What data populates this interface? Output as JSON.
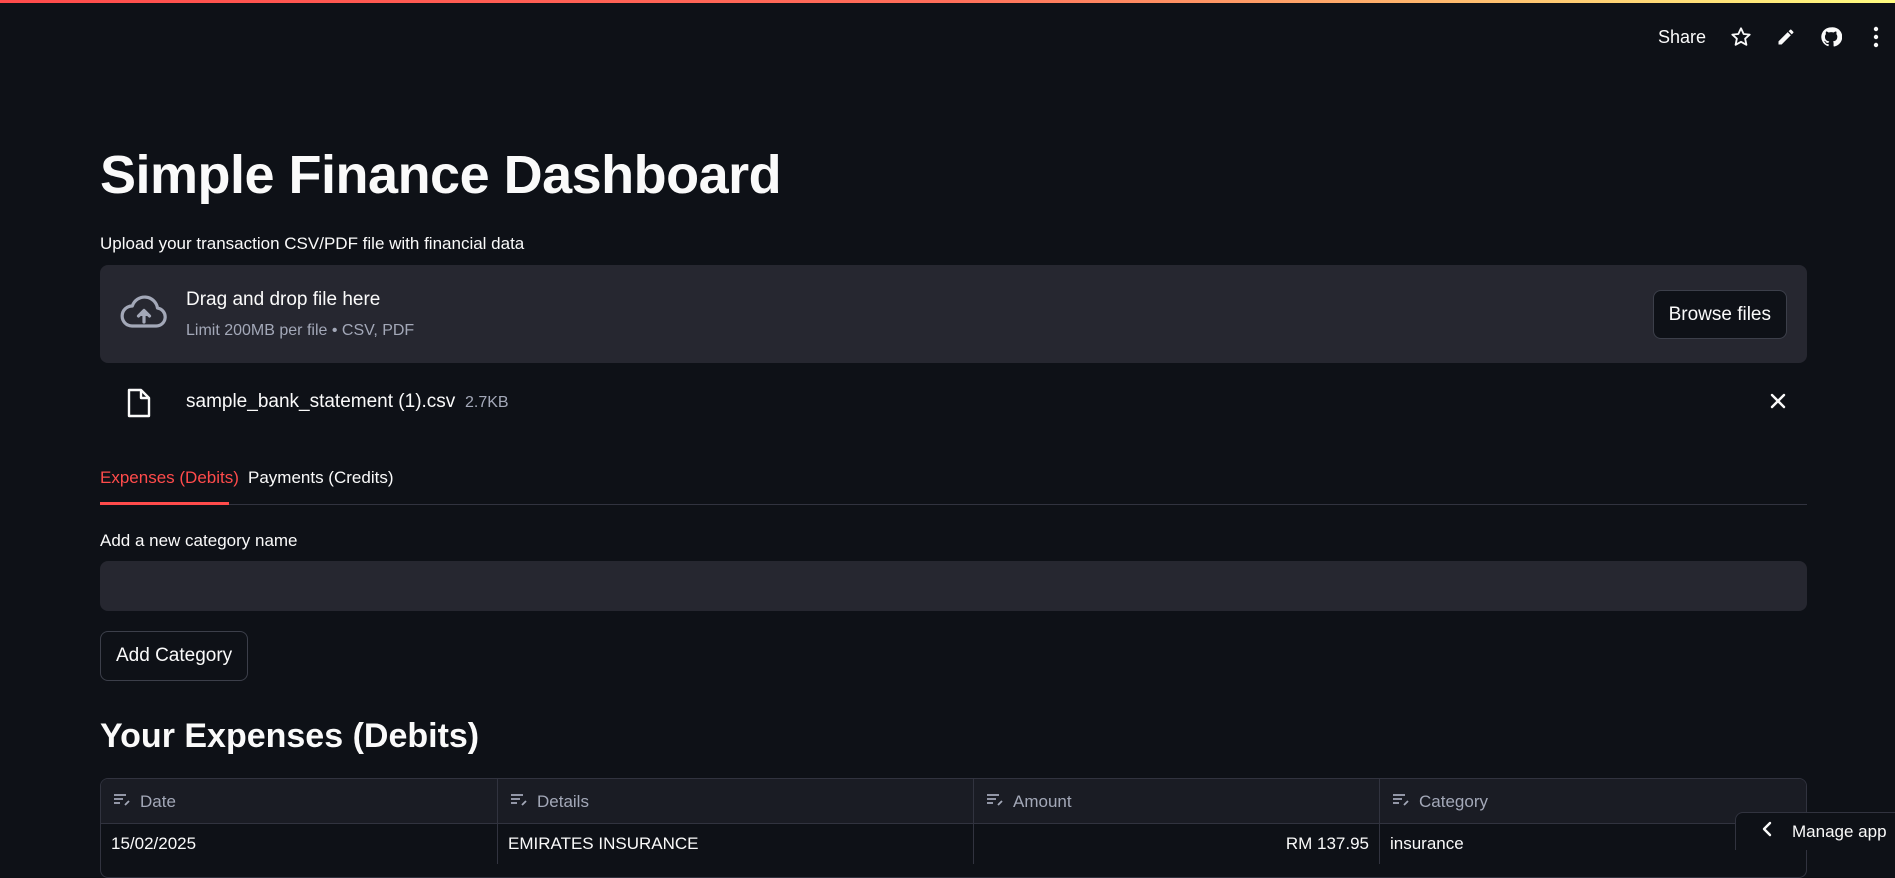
{
  "toolbar": {
    "share_label": "Share",
    "icons": [
      "star-icon",
      "pencil-icon",
      "github-icon",
      "more-vertical-icon"
    ]
  },
  "page": {
    "title": "Simple Finance Dashboard"
  },
  "uploader": {
    "label": "Upload your transaction CSV/PDF file with financial data",
    "drop_title": "Drag and drop file here",
    "limit_text": "Limit 200MB per file • CSV, PDF",
    "browse_label": "Browse files",
    "file_name": "sample_bank_statement (1).csv",
    "file_size": "2.7KB"
  },
  "tabs": [
    {
      "label": "Expenses (Debits)",
      "active": true
    },
    {
      "label": "Payments (Credits)",
      "active": false
    }
  ],
  "category_form": {
    "label": "Add a new category name",
    "value": "",
    "button_label": "Add Category"
  },
  "expenses": {
    "heading": "Your Expenses (Debits)",
    "columns": [
      "Date",
      "Details",
      "Amount",
      "Category"
    ],
    "rows": [
      {
        "date": "15/02/2025",
        "details": "EMIRATES INSURANCE",
        "amount": "RM 137.95",
        "category": "insurance"
      }
    ]
  },
  "manage_app_label": "Manage app",
  "colors": {
    "accent": "#ff4b4b",
    "background": "#0e1117",
    "surface": "#262730"
  }
}
